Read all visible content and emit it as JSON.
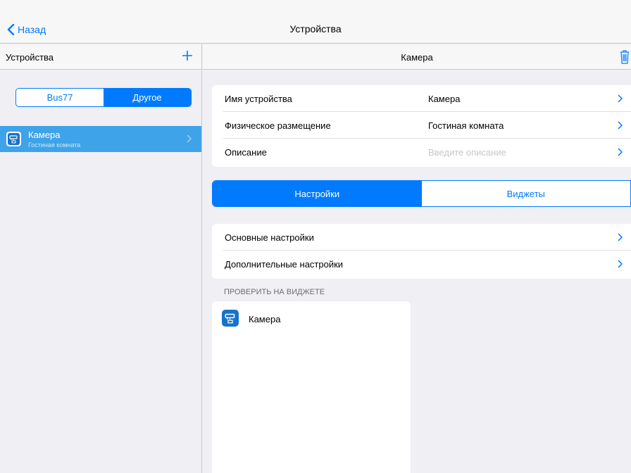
{
  "nav": {
    "back_label": "Назад",
    "title": "Устройства"
  },
  "sidebar": {
    "title": "Устройства",
    "add_icon": "plus-icon",
    "segments": [
      "Bus77",
      "Другое"
    ],
    "selected_segment": "Другое",
    "devices": [
      {
        "name": "Камера",
        "location": "Гостиная комната",
        "icon": "camera-icon"
      }
    ]
  },
  "main": {
    "title": "Камера",
    "trash_icon": "trash-icon",
    "info_rows": [
      {
        "label": "Имя устройства",
        "value": "Камера"
      },
      {
        "label": "Физическое размещение",
        "value": "Гостиная комната"
      },
      {
        "label": "Описание",
        "placeholder": "Введите описание"
      }
    ],
    "tabs": [
      "Настройки",
      "Виджеты"
    ],
    "active_tab": "Настройки",
    "settings_rows": [
      {
        "label": "Основные настройки"
      },
      {
        "label": "Дополнительные настройки"
      }
    ],
    "widget_section_label": "ПРОВЕРИТЬ НА ВИДЖЕТЕ",
    "widget": {
      "label": "Камера",
      "icon": "camera-icon"
    }
  },
  "colors": {
    "accent": "#007aff",
    "selected_row": "#3ea3e8",
    "background": "#efeff4"
  }
}
